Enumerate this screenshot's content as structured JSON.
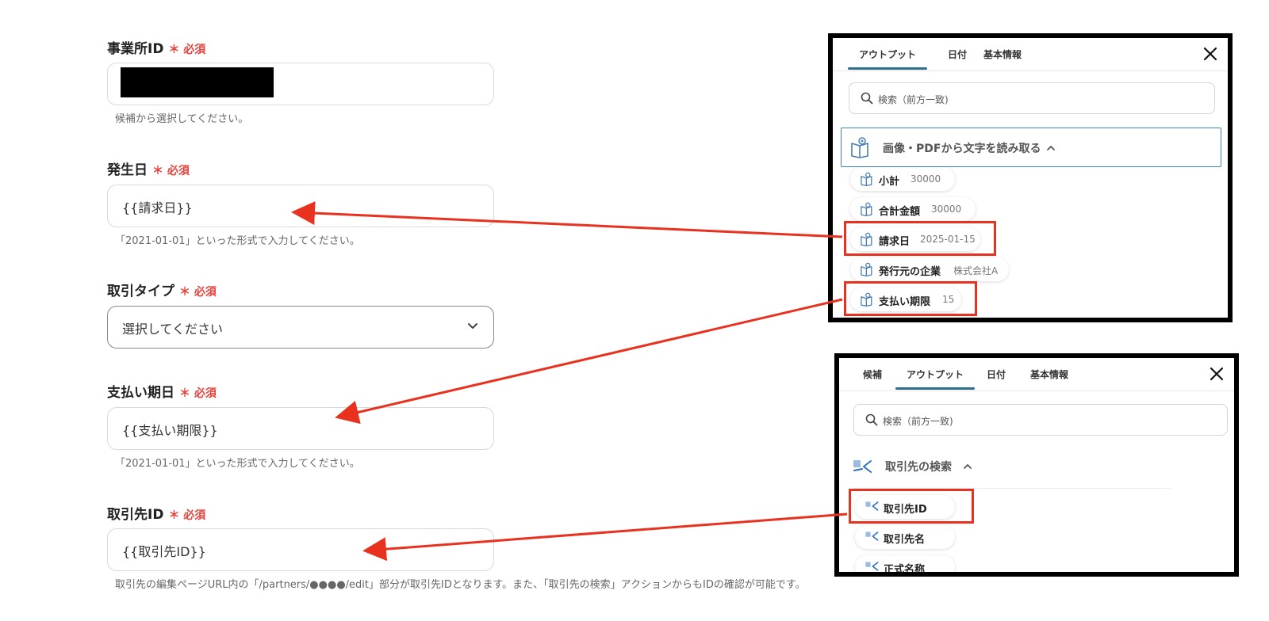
{
  "form": {
    "office_id": {
      "label": "事業所ID",
      "required": "＊ 必須",
      "hint": "候補から選択してください。"
    },
    "occur_date": {
      "label": "発生日",
      "required": "＊ 必須",
      "value": "{{請求日}}",
      "hint": "「2021-01-01」といった形式で入力してください。"
    },
    "trade_type": {
      "label": "取引タイプ",
      "required": "＊ 必須",
      "value": "選択してください"
    },
    "due_date": {
      "label": "支払い期日",
      "required": "＊ 必須",
      "value": "{{支払い期限}}",
      "hint": "「2021-01-01」といった形式で入力してください。"
    },
    "partner_id": {
      "label": "取引先ID",
      "required": "＊ 必須",
      "value": "{{取引先ID}}",
      "hint": "取引先の編集ページURL内の「/partners/●●●●/edit」部分が取引先IDとなります。また、「取引先の検索」アクションからもIDの確認が可能です。"
    }
  },
  "popup1": {
    "tabs": [
      "アウトプット",
      "日付",
      "基本情報"
    ],
    "active_tab": "アウトプット",
    "search_placeholder": "検索（前方一致)",
    "group_title": "画像・PDFから文字を読み取る",
    "items": [
      {
        "name": "小計",
        "value": "30000"
      },
      {
        "name": "合計金額",
        "value": "30000"
      },
      {
        "name": "請求日",
        "value": "2025-01-15"
      },
      {
        "name": "発行元の企業",
        "value": "株式会社A"
      },
      {
        "name": "支払い期限",
        "value": "15"
      }
    ]
  },
  "popup2": {
    "tabs": [
      "候補",
      "アウトプット",
      "日付",
      "基本情報"
    ],
    "active_tab": "アウトプット",
    "search_placeholder": "検索（前方一致)",
    "group_title": "取引先の検索",
    "items": [
      {
        "name": "取引先ID"
      },
      {
        "name": "取引先名"
      },
      {
        "name": "正式名称"
      }
    ]
  },
  "colors": {
    "accent_tab": "#2c6f8f",
    "required_red": "#e8413c",
    "annotation_red": "#e8321f",
    "icon_blue": "#4a7fb5"
  },
  "icons": [
    "search-icon",
    "close-icon",
    "chevron-down-icon",
    "book-eye-icon",
    "search-arrow-icon"
  ]
}
